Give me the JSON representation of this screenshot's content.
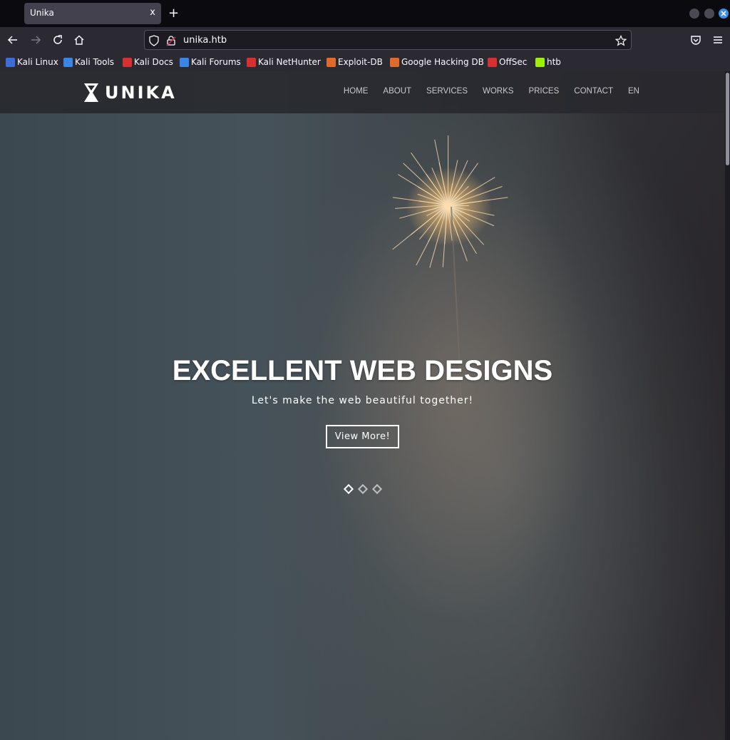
{
  "browser": {
    "tab_title": "Unika",
    "tab_close": "x",
    "new_tab": "+",
    "url": "unika.htb"
  },
  "bookmarks": [
    {
      "label": "Kali Linux",
      "color": "#3d6dd8"
    },
    {
      "label": "Kali Tools",
      "color": "#3a86e8"
    },
    {
      "label": "Kali Docs",
      "color": "#d83030"
    },
    {
      "label": "Kali Forums",
      "color": "#3a86e8"
    },
    {
      "label": "Kali NetHunter",
      "color": "#d83030"
    },
    {
      "label": "Exploit-DB",
      "color": "#e06a2a"
    },
    {
      "label": "Google Hacking DB",
      "color": "#e06a2a"
    },
    {
      "label": "OffSec",
      "color": "#d83030"
    },
    {
      "label": "htb",
      "color": "#9fef00"
    }
  ],
  "site": {
    "logo_text": "UNIKA",
    "nav": [
      "HOME",
      "ABOUT",
      "SERVICES",
      "WORKS",
      "PRICES",
      "CONTACT",
      "EN"
    ]
  },
  "hero": {
    "title": "EXCELLENT WEB DESIGNS",
    "subtitle": "Let's make the web beautiful together!",
    "button": "View More!",
    "slides_total": 3,
    "active_slide": 1
  }
}
